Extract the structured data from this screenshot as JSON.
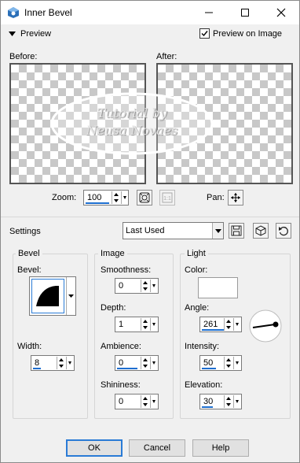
{
  "window": {
    "title": "Inner Bevel"
  },
  "preview": {
    "toggle_label": "Preview",
    "preview_on_image_label": "Preview on Image",
    "preview_on_image_checked": true,
    "before_label": "Before:",
    "after_label": "After:",
    "watermark_line1": "Tutorial by",
    "watermark_line2": "Neusa Novaes",
    "zoom_label": "Zoom:",
    "zoom_value": "100",
    "pan_label": "Pan:"
  },
  "settings": {
    "label": "Settings",
    "preset_value": "Last Used"
  },
  "bevel": {
    "group_title": "Bevel",
    "bevel_label": "Bevel:",
    "width_label": "Width:",
    "width_value": "8"
  },
  "image": {
    "group_title": "Image",
    "smoothness_label": "Smoothness:",
    "smoothness_value": "0",
    "depth_label": "Depth:",
    "depth_value": "1",
    "ambience_label": "Ambience:",
    "ambience_value": "0",
    "shininess_label": "Shininess:",
    "shininess_value": "0"
  },
  "light": {
    "group_title": "Light",
    "color_label": "Color:",
    "color_value": "#ffffff",
    "angle_label": "Angle:",
    "angle_value": "261",
    "intensity_label": "Intensity:",
    "intensity_value": "50",
    "elevation_label": "Elevation:",
    "elevation_value": "30"
  },
  "buttons": {
    "ok": "OK",
    "cancel": "Cancel",
    "help": "Help"
  },
  "colors": {
    "accent": "#1e6fd0",
    "default_button_border": "#2a7bd6",
    "dialog_bg": "#f0f0f0"
  }
}
